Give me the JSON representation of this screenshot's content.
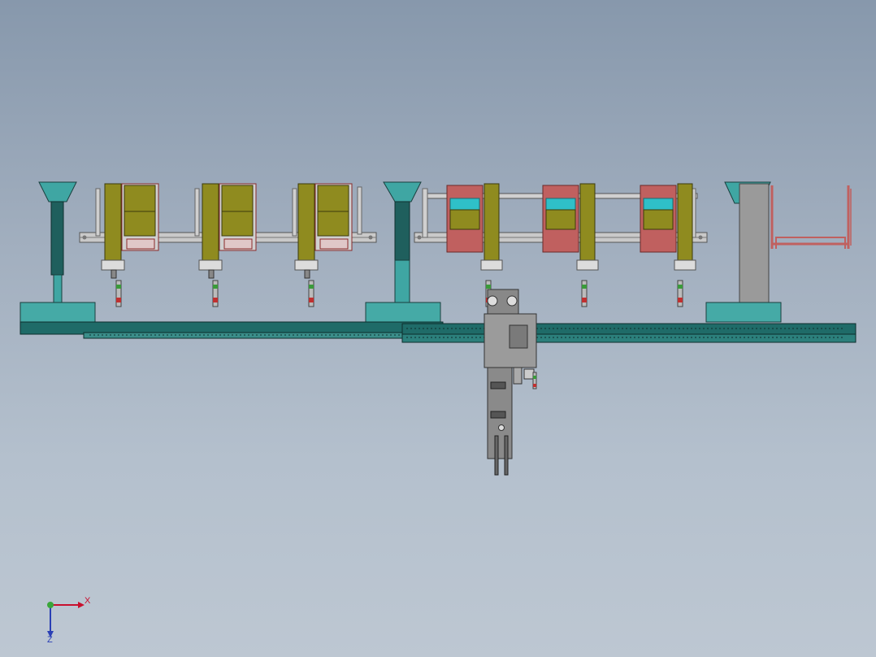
{
  "viewport": {
    "background_top": "#8798ac",
    "background_bottom": "#bdc7d2"
  },
  "colors": {
    "teal": "#3fa6a3",
    "dark_teal": "#1f5f5d",
    "olive": "#8f8b1f",
    "red_frame": "#c0605f",
    "cyan": "#2fc0c8",
    "grey": "#9a9a9a",
    "dark_grey": "#555555"
  },
  "triad": {
    "x_label": "X",
    "z_label": "Z"
  }
}
